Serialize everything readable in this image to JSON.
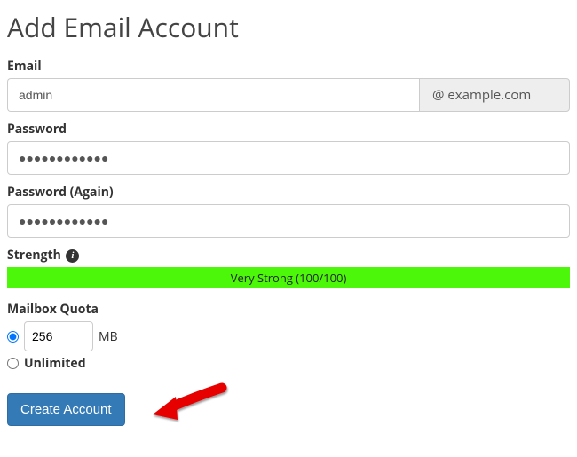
{
  "page": {
    "title": "Add Email Account"
  },
  "email": {
    "label": "Email",
    "value": "admin",
    "domain": "@ example.com"
  },
  "password": {
    "label": "Password",
    "value": "●●●●●●●●●●●●"
  },
  "password_again": {
    "label": "Password (Again)",
    "value": "●●●●●●●●●●●●"
  },
  "strength": {
    "label": "Strength",
    "info_icon": "info-icon",
    "text": "Very Strong (100/100)",
    "color": "#4df70a"
  },
  "quota": {
    "label": "Mailbox Quota",
    "value": "256",
    "unit": "MB",
    "unlimited_label": "Unlimited",
    "selected": "limited"
  },
  "submit": {
    "label": "Create Account"
  }
}
